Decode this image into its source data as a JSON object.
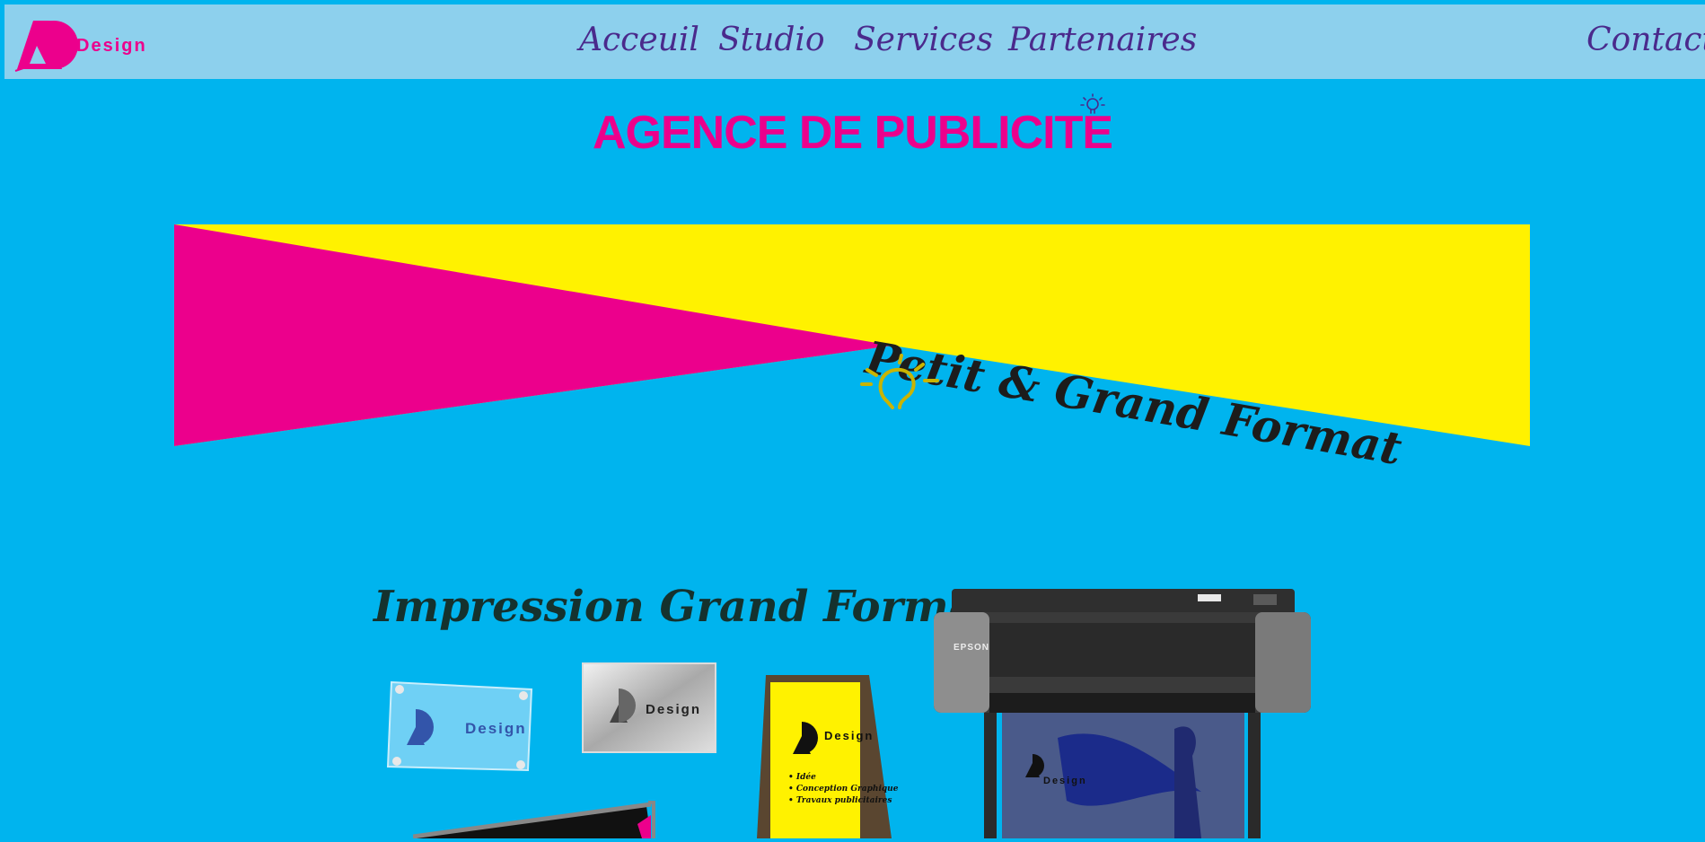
{
  "nav": {
    "logo_text": "Design",
    "links": [
      "Acceuil",
      "Studio",
      "Services",
      "Partenaires"
    ],
    "contact": "Contact"
  },
  "page_title": "AGENCE DE PUBLICITE",
  "banner": {
    "text": "Petit & Grand Format"
  },
  "section": {
    "title": "Impression Grand Format",
    "glass_sign_text": "Design",
    "metal_sign_text": "Design",
    "board_brand_text": "Design",
    "board_list": [
      "• Idée",
      "• Conception Graphique",
      "• Travaux publicitaires"
    ],
    "printer_brand": "EPSON",
    "poster_brand_text": "Design"
  },
  "colors": {
    "background": "#00b4ee",
    "nav_bg": "#8dd0ed",
    "brand_pink": "#ec008c",
    "brand_yellow": "#fff200",
    "nav_text": "#4a2a8c"
  },
  "icons": [
    "logo-mark-icon",
    "lightbulb-icon"
  ]
}
